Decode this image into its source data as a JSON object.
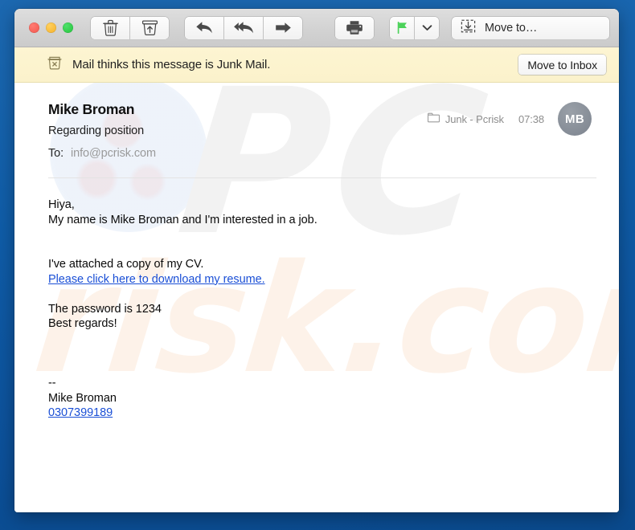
{
  "window": {
    "traffic_lights": [
      {
        "name": "close",
        "color": "#f2564c"
      },
      {
        "name": "minimize",
        "color": "#f4b028"
      },
      {
        "name": "zoom",
        "color": "#24c33c"
      }
    ]
  },
  "toolbar": {
    "groups": [
      {
        "name": "delete-group",
        "buttons": [
          {
            "name": "delete-button",
            "icon": "trash-icon",
            "tooltip": "Delete"
          },
          {
            "name": "archive-button",
            "icon": "archive-box-icon",
            "tooltip": "Archive"
          }
        ]
      },
      {
        "name": "reply-group",
        "buttons": [
          {
            "name": "reply-button",
            "icon": "reply-arrow-icon",
            "tooltip": "Reply"
          },
          {
            "name": "reply-all-button",
            "icon": "reply-all-arrow-icon",
            "tooltip": "Reply All"
          },
          {
            "name": "forward-button",
            "icon": "forward-arrow-icon",
            "tooltip": "Forward"
          }
        ]
      },
      {
        "name": "print-group",
        "buttons": [
          {
            "name": "print-button",
            "icon": "printer-icon",
            "tooltip": "Print"
          }
        ]
      },
      {
        "name": "flag-group",
        "buttons": [
          {
            "name": "flag-button",
            "icon": "flag-icon",
            "tooltip": "Flag",
            "color": "#4cd25a"
          },
          {
            "name": "flag-menu-button",
            "icon": "chevron-down-icon",
            "tooltip": "Flag options"
          }
        ]
      }
    ],
    "move_to": {
      "label": "Move to…",
      "icon": "move-to-box-icon"
    }
  },
  "junk_banner": {
    "icon": "junk-bin-icon",
    "message": "Mail thinks this message is Junk Mail.",
    "action_label": "Move to Inbox",
    "background_color": "#fbf2cb"
  },
  "message": {
    "sender": "Mike Broman",
    "subject": "Regarding position",
    "to_label": "To:",
    "to_value": "info@pcrisk.com",
    "mailbox_icon": "folder-icon",
    "mailbox": "Junk - Pcrisk",
    "time": "07:38",
    "avatar_initials": "MB",
    "body_lines": [
      {
        "type": "text",
        "text": "Hiya,"
      },
      {
        "type": "text",
        "text": "My name is Mike Broman and I'm interested in a job."
      },
      {
        "type": "blank"
      },
      {
        "type": "blank"
      },
      {
        "type": "text",
        "text": "I've attached a copy of my CV."
      },
      {
        "type": "link",
        "text": "Please click here to download my resume."
      },
      {
        "type": "blank"
      },
      {
        "type": "text",
        "text": "The password is 1234"
      },
      {
        "type": "text",
        "text": "Best regards!"
      },
      {
        "type": "blank"
      },
      {
        "type": "blank"
      },
      {
        "type": "blank"
      },
      {
        "type": "text",
        "text": "--"
      },
      {
        "type": "text",
        "text": "Mike Broman"
      },
      {
        "type": "link",
        "text": "0307399189"
      }
    ]
  },
  "watermark": {
    "primary_text": "PC",
    "secondary_text": "risk.com",
    "primary_color": "#f2f2f2",
    "secondary_color": "#fdf2e9"
  }
}
